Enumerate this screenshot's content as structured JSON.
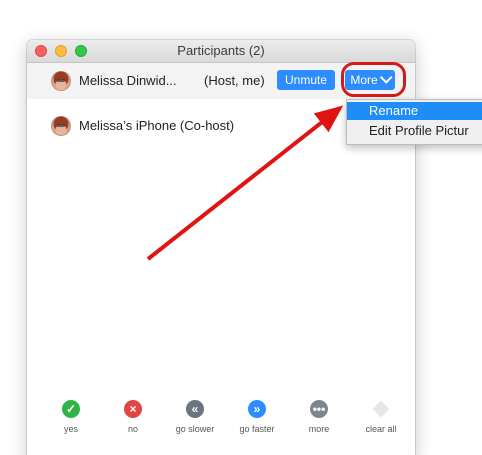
{
  "window": {
    "title": "Participants (2)"
  },
  "participants": [
    {
      "name": "Melissa Dinwid...",
      "role": "(Host, me)",
      "unmute_label": "Unmute",
      "more_label": "More"
    },
    {
      "name": "Melissa’s iPhone (Co-host)"
    }
  ],
  "more_menu": {
    "items": [
      "Rename",
      "Edit Profile Pictur"
    ]
  },
  "reactions": [
    {
      "label": "yes",
      "icon": "check-icon"
    },
    {
      "label": "no",
      "icon": "x-icon"
    },
    {
      "label": "go slower",
      "icon": "double-left-icon"
    },
    {
      "label": "go faster",
      "icon": "double-right-icon"
    },
    {
      "label": "more",
      "icon": "ellipsis-icon"
    },
    {
      "label": "clear all",
      "icon": "eraser-icon"
    }
  ],
  "colors": {
    "zoom_blue": "#2d8cff",
    "annotation_red": "#d31b1b",
    "yes_green": "#2fb545",
    "no_red": "#e04545"
  }
}
